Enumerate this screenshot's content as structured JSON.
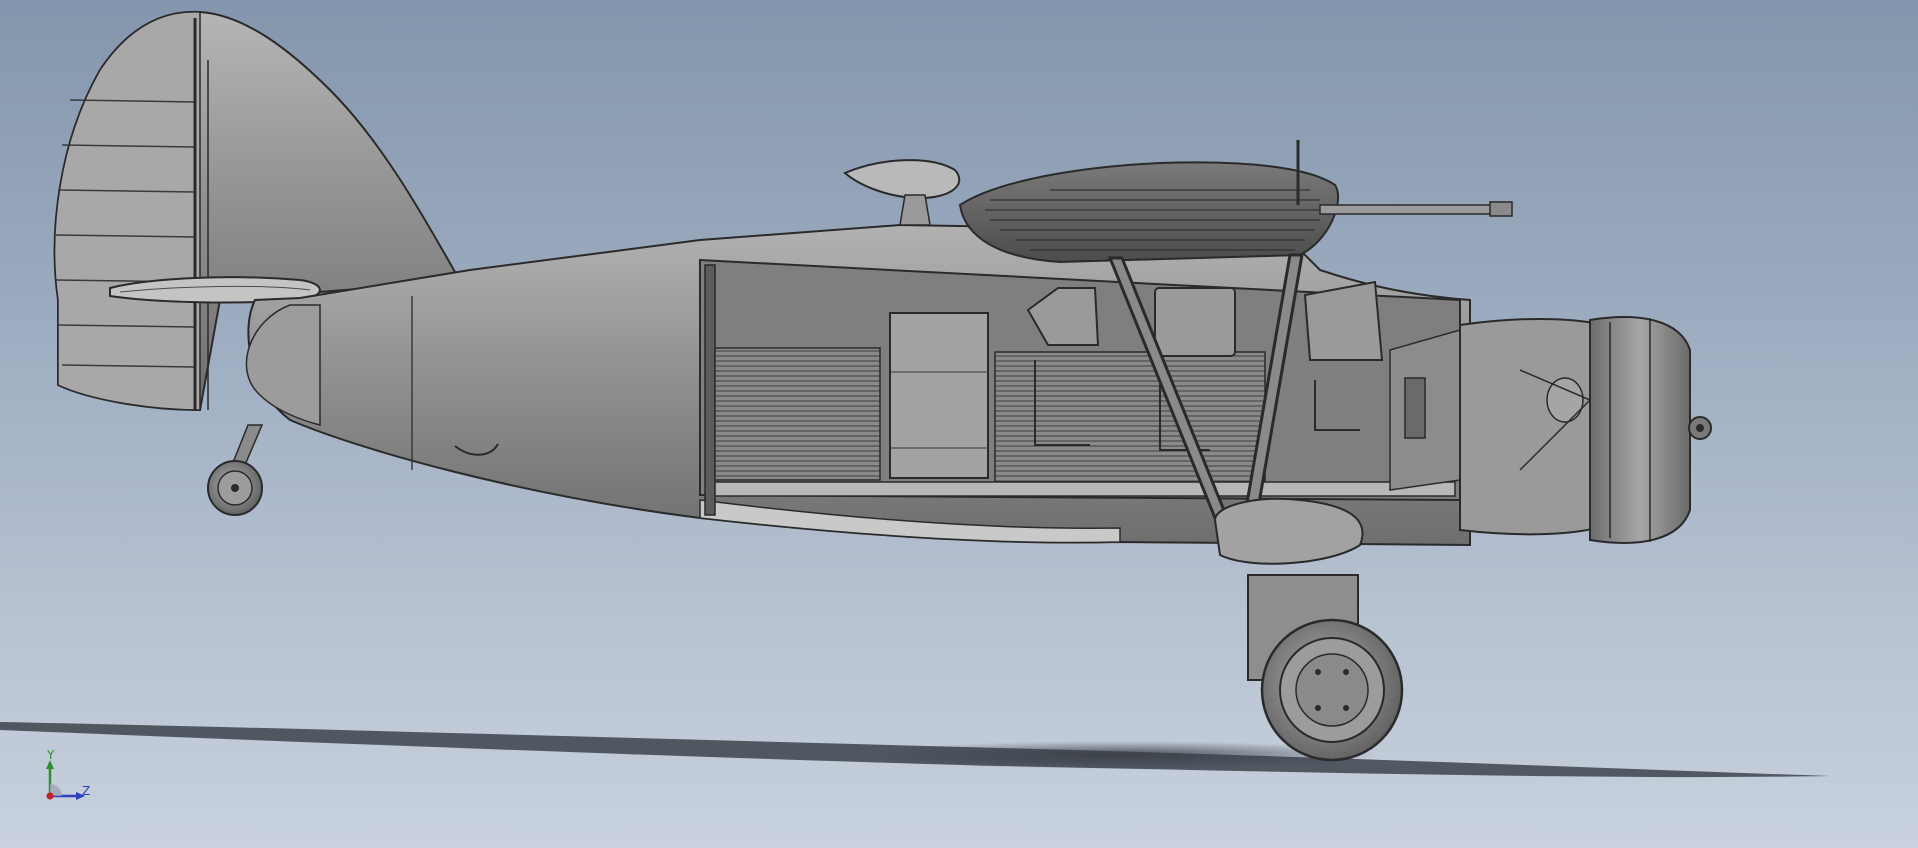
{
  "scene": {
    "model": "biplane-cad-model",
    "view": "right side"
  },
  "triad": {
    "y_label": "Y",
    "z_label": "Z"
  },
  "colors": {
    "background_top": "#8496ad",
    "background_bottom": "#c8d1dd",
    "model_fill": "#9a9a9a",
    "model_edge": "#2a2a2a",
    "axis_y": "#2f8f2f",
    "axis_z": "#2b3fbf",
    "axis_x": "#c02020"
  }
}
